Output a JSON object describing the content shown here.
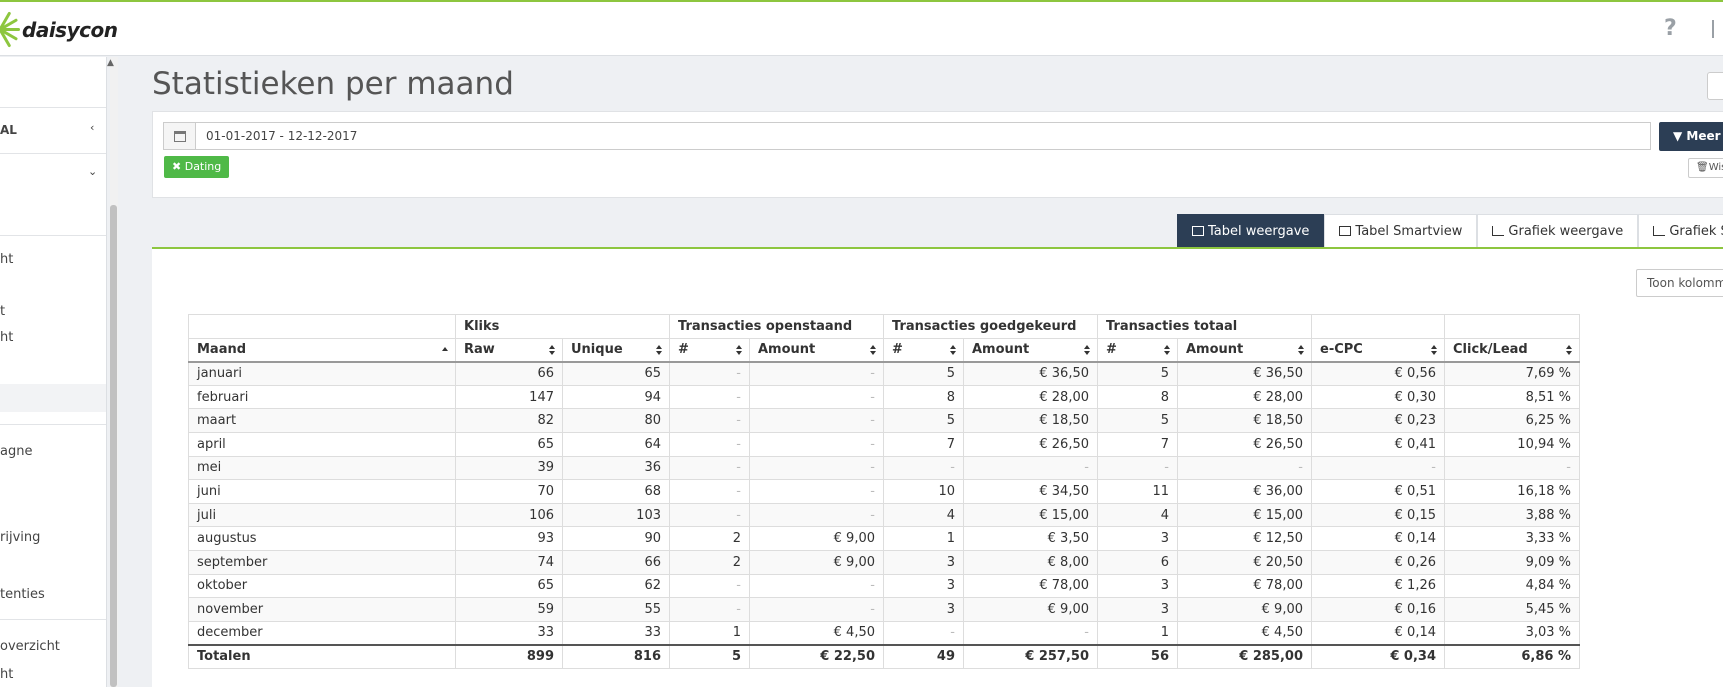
{
  "brand": {
    "name": "daisycon",
    "accent": "#8dc63f"
  },
  "header": {
    "help_icon": "?"
  },
  "sidebar": {
    "items": [
      {
        "label": "AL",
        "bold": true
      },
      {
        "label": "ht"
      },
      {
        "label": "t"
      },
      {
        "label": "ht"
      },
      {
        "label": "agne"
      },
      {
        "label": "rijving"
      },
      {
        "label": "tenties"
      },
      {
        "label": "overzicht"
      },
      {
        "label": "ht"
      }
    ]
  },
  "page": {
    "title": "Statistieken per maand"
  },
  "filter": {
    "date_range": "01-01-2017 - 12-12-2017",
    "meer_button": "Meer f",
    "dating_badge": "Dating",
    "wis_button": "Wis"
  },
  "tabs": [
    {
      "label": "Tabel weergave",
      "active": true
    },
    {
      "label": "Tabel Smartview",
      "active": false
    },
    {
      "label": "Grafiek weergave",
      "active": false
    },
    {
      "label": "Grafiek Sma",
      "active": false
    }
  ],
  "toon_button": "Toon kolomm",
  "table": {
    "group_headers": [
      "Kliks",
      "Transacties openstaand",
      "Transacties goedgekeurd",
      "Transacties totaal"
    ],
    "columns": [
      "Maand",
      "Raw",
      "Unique",
      "#",
      "Amount",
      "#",
      "Amount",
      "#",
      "Amount",
      "e-CPC",
      "Click/Lead"
    ],
    "rows": [
      [
        "januari",
        "66",
        "65",
        "-",
        "-",
        "5",
        "€ 36,50",
        "5",
        "€ 36,50",
        "€ 0,56",
        "7,69 %"
      ],
      [
        "februari",
        "147",
        "94",
        "-",
        "-",
        "8",
        "€ 28,00",
        "8",
        "€ 28,00",
        "€ 0,30",
        "8,51 %"
      ],
      [
        "maart",
        "82",
        "80",
        "-",
        "-",
        "5",
        "€ 18,50",
        "5",
        "€ 18,50",
        "€ 0,23",
        "6,25 %"
      ],
      [
        "april",
        "65",
        "64",
        "-",
        "-",
        "7",
        "€ 26,50",
        "7",
        "€ 26,50",
        "€ 0,41",
        "10,94 %"
      ],
      [
        "mei",
        "39",
        "36",
        "-",
        "-",
        "-",
        "-",
        "-",
        "-",
        "-",
        "-"
      ],
      [
        "juni",
        "70",
        "68",
        "-",
        "-",
        "10",
        "€ 34,50",
        "11",
        "€ 36,00",
        "€ 0,51",
        "16,18 %"
      ],
      [
        "juli",
        "106",
        "103",
        "-",
        "-",
        "4",
        "€ 15,00",
        "4",
        "€ 15,00",
        "€ 0,15",
        "3,88 %"
      ],
      [
        "augustus",
        "93",
        "90",
        "2",
        "€ 9,00",
        "1",
        "€ 3,50",
        "3",
        "€ 12,50",
        "€ 0,14",
        "3,33 %"
      ],
      [
        "september",
        "74",
        "66",
        "2",
        "€ 9,00",
        "3",
        "€ 8,00",
        "6",
        "€ 20,50",
        "€ 0,26",
        "9,09 %"
      ],
      [
        "oktober",
        "65",
        "62",
        "-",
        "-",
        "3",
        "€ 78,00",
        "3",
        "€ 78,00",
        "€ 1,26",
        "4,84 %"
      ],
      [
        "november",
        "59",
        "55",
        "-",
        "-",
        "3",
        "€ 9,00",
        "3",
        "€ 9,00",
        "€ 0,16",
        "5,45 %"
      ],
      [
        "december",
        "33",
        "33",
        "1",
        "€ 4,50",
        "-",
        "-",
        "1",
        "€ 4,50",
        "€ 0,14",
        "3,03 %"
      ]
    ],
    "totals": [
      "Totalen",
      "899",
      "816",
      "5",
      "€ 22,50",
      "49",
      "€ 257,50",
      "56",
      "€ 285,00",
      "€ 0,34",
      "6,86 %"
    ]
  }
}
